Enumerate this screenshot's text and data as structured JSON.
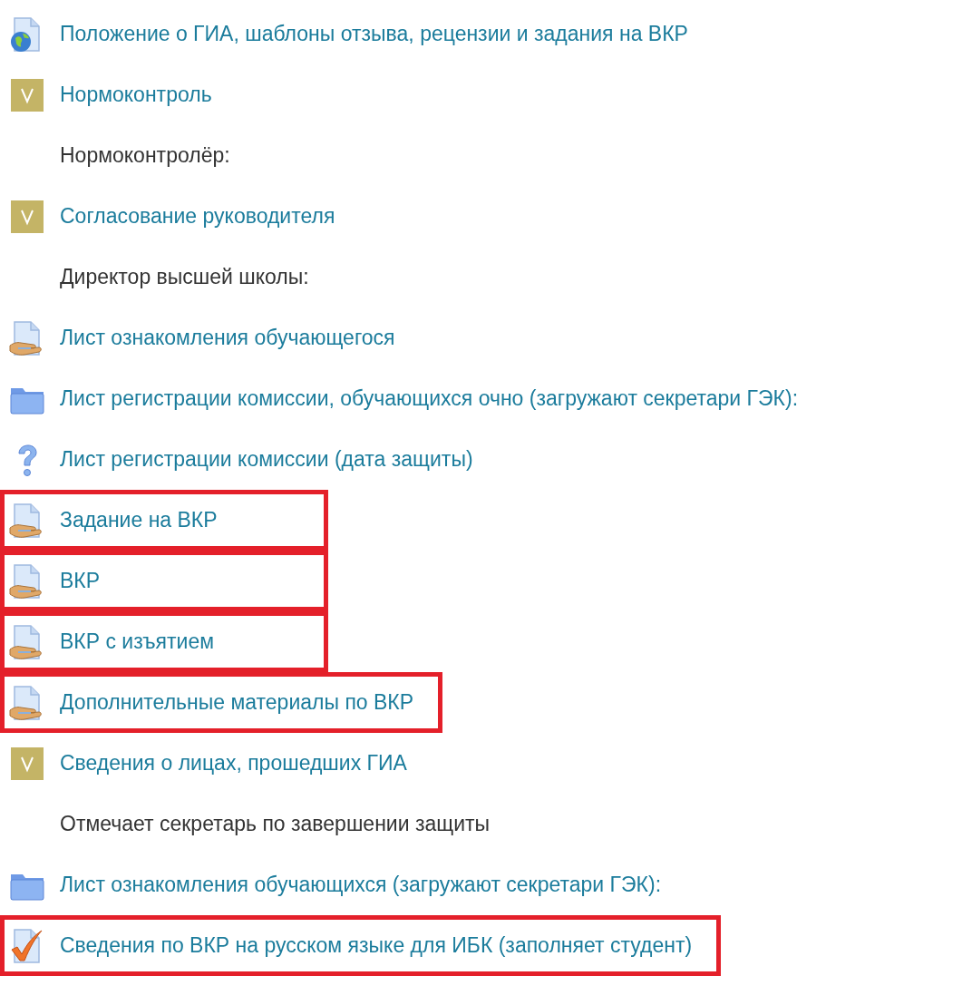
{
  "items": [
    {
      "kind": "url",
      "text": "Положение о ГИА, шаблоны отзыва, рецензии и задания на ВКР",
      "highlighted": false
    },
    {
      "kind": "assignment",
      "text": "Нормоконтроль",
      "highlighted": false
    },
    {
      "kind": "label",
      "text": "Нормоконтролёр:",
      "highlighted": false
    },
    {
      "kind": "assignment",
      "text": "Согласование руководителя",
      "highlighted": false
    },
    {
      "kind": "label",
      "text": "Директор высшей школы:",
      "highlighted": false
    },
    {
      "kind": "workshop",
      "text": "Лист ознакомления обучающегося",
      "highlighted": false
    },
    {
      "kind": "folder",
      "text": "Лист регистрации комиссии, обучающихся очно (загружают секретари ГЭК):",
      "highlighted": false
    },
    {
      "kind": "feedback",
      "text": "Лист регистрации комиссии (дата защиты)",
      "highlighted": false
    },
    {
      "kind": "workshop",
      "text": "Задание на ВКР",
      "highlighted": true
    },
    {
      "kind": "workshop",
      "text": "ВКР",
      "highlighted": true
    },
    {
      "kind": "workshop",
      "text": "ВКР с изъятием",
      "highlighted": true
    },
    {
      "kind": "workshop",
      "text": "Дополнительные материалы по ВКР",
      "highlighted": true
    },
    {
      "kind": "assignment",
      "text": "Сведения о лицах, прошедших ГИА",
      "highlighted": false
    },
    {
      "kind": "label",
      "text": "Отмечает секретарь по завершении защиты",
      "highlighted": false
    },
    {
      "kind": "folder",
      "text": "Лист ознакомления обучающихся (загружают секретари ГЭК):",
      "highlighted": false
    },
    {
      "kind": "checklist",
      "text": "Сведения по ВКР на русском языке для ИБК (заполняет студент)",
      "highlighted": true
    }
  ]
}
